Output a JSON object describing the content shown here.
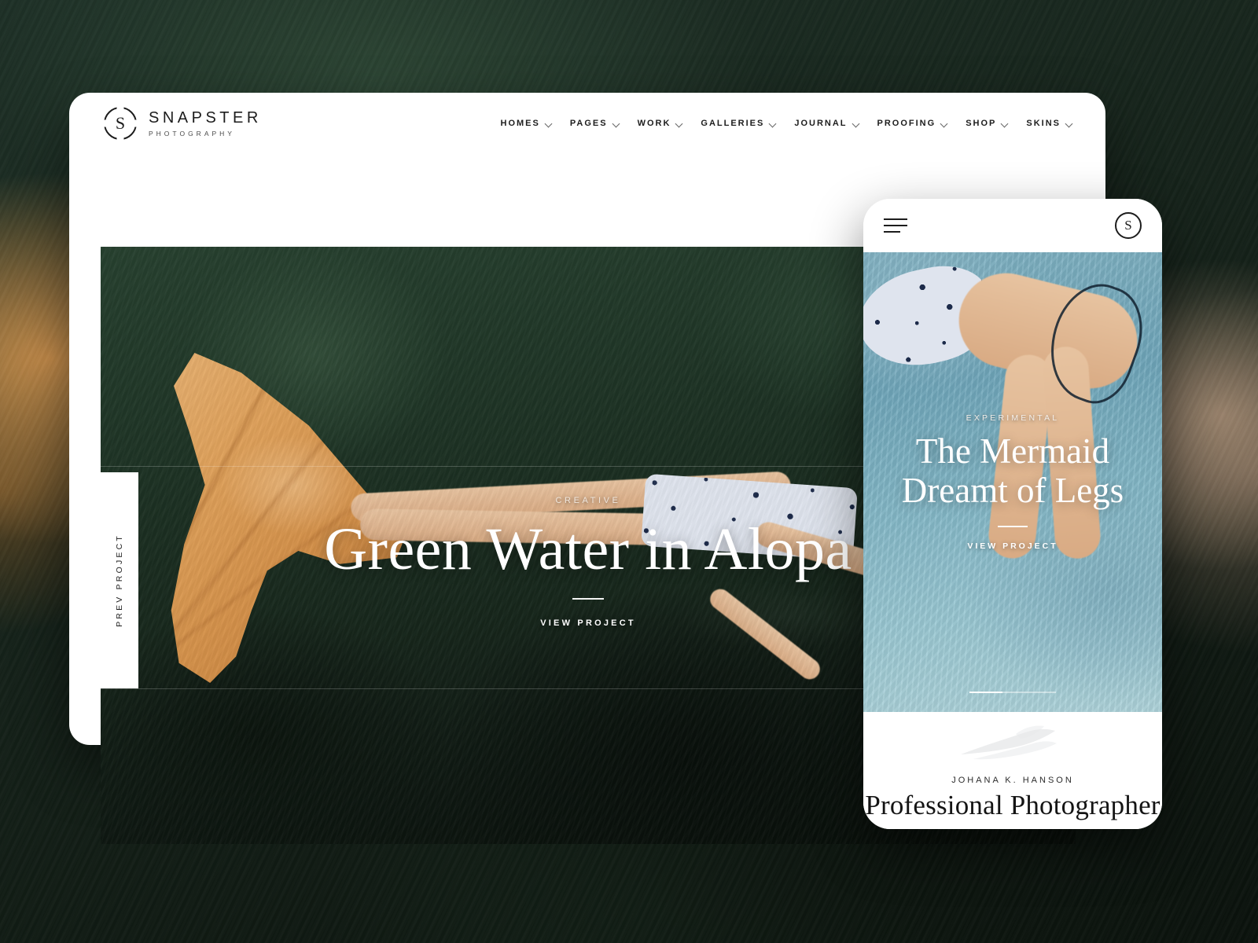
{
  "background": {
    "description": "dark-green-water-photo",
    "color": "#16241b"
  },
  "tablet": {
    "logo": {
      "mark": "S",
      "brand": "SNAPSTER",
      "tagline": "PHOTOGRAPHY"
    },
    "nav": [
      {
        "label": "HOMES",
        "has_dropdown": true
      },
      {
        "label": "PAGES",
        "has_dropdown": true
      },
      {
        "label": "WORK",
        "has_dropdown": true
      },
      {
        "label": "GALLERIES",
        "has_dropdown": true
      },
      {
        "label": "JOURNAL",
        "has_dropdown": true
      },
      {
        "label": "PROOFING",
        "has_dropdown": true
      },
      {
        "label": "SHOP",
        "has_dropdown": true
      },
      {
        "label": "SKINS",
        "has_dropdown": true
      }
    ],
    "hero": {
      "eyebrow": "CREATIVE",
      "title": "Green Water in Alopa",
      "cta": "VIEW PROJECT",
      "prev_label": "PREV PROJECT"
    }
  },
  "phone": {
    "logo_mark": "S",
    "menu_icon": "hamburger-icon",
    "hero": {
      "eyebrow": "EXPERIMENTAL",
      "title_line1": "The Mermaid",
      "title_line2": "Dreamt of Legs",
      "cta": "VIEW PROJECT"
    },
    "footer": {
      "name": "JOHANA K. HANSON",
      "role": "Professional Photographer",
      "ornament": "feather-icon"
    }
  },
  "colors": {
    "brand_dark": "#1c1c1c",
    "water_green": "#1e3325",
    "water_blue": "#7fb1c2",
    "tail_orange": "#d4914a",
    "white": "#ffffff"
  }
}
